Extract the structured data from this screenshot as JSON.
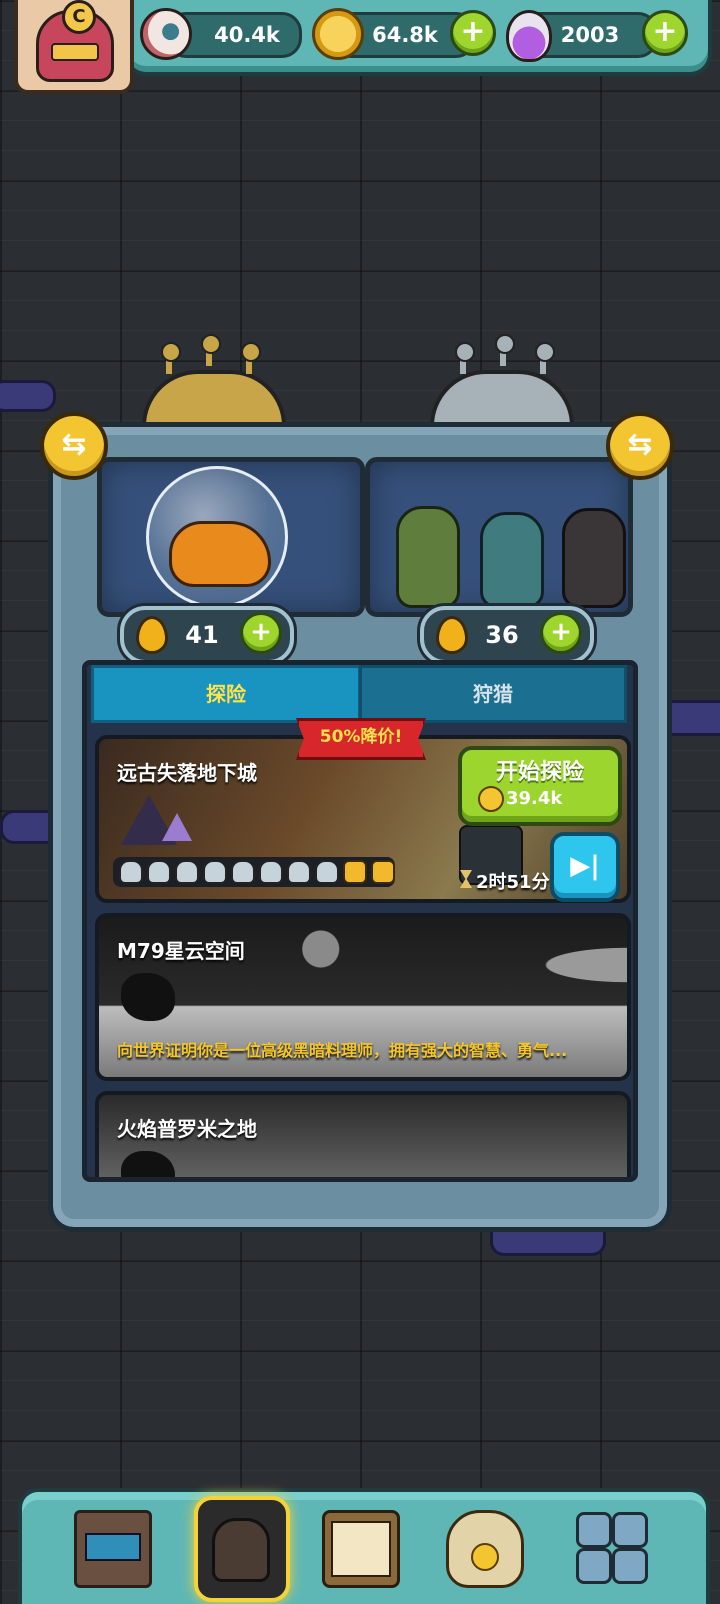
{
  "resources": {
    "eyeball_value": "40.4k",
    "coin_value": "64.8k",
    "potion_value": "2003"
  },
  "icons": {
    "avatar_emblem_letter": "C",
    "plus": "+",
    "swap": "⇆",
    "skip": "▶|"
  },
  "capsules": {
    "left_droplets": "41",
    "right_droplets": "36"
  },
  "tabs": {
    "explore": "探险",
    "hunt": "狩猎"
  },
  "cards": [
    {
      "title": "远古失落地下城",
      "sale_banner": "50%降价!",
      "start_button": "开始探险",
      "start_cost": "39.4k",
      "timer": "2时51分",
      "progress_skulls": 8,
      "progress_gold": 2
    },
    {
      "title": "M79星云空间",
      "description": "向世界证明你是一位高级黑暗料理师，拥有强大的智慧、勇气..."
    },
    {
      "title": "火焰普罗米之地"
    }
  ],
  "colors": {
    "accent_green": "#9bd52d",
    "accent_teal": "#5fb7b5",
    "tab_active": "#1993c0",
    "sale_red": "#d8272a",
    "gold": "#f3c531"
  }
}
